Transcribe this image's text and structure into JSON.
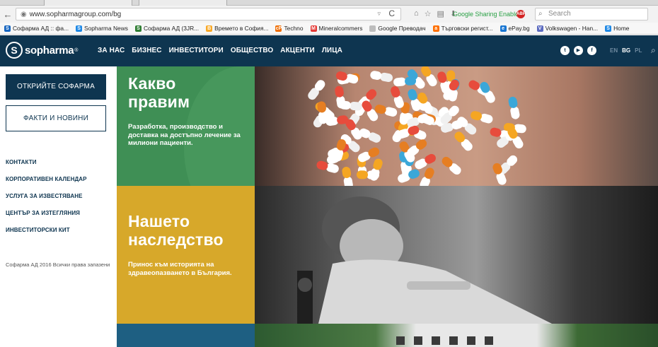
{
  "browser": {
    "url": "www.sopharmagroup.com/bg",
    "google_sharing": "Google Sharing Enabled",
    "search_placeholder": "Search",
    "bookmarks": [
      {
        "label": "Софарма АД :: фа...",
        "color": "#1565c0",
        "glyph": "S"
      },
      {
        "label": "Sopharma News",
        "color": "#1e88e5",
        "glyph": "S"
      },
      {
        "label": "Софарма АД (3JR...",
        "color": "#2e7d32",
        "glyph": "S"
      },
      {
        "label": "Времето в София...",
        "color": "#f9a825",
        "glyph": "B"
      },
      {
        "label": "Techno",
        "color": "#ef6c00",
        "glyph": "cP"
      },
      {
        "label": "Mineralcommers",
        "color": "#e53935",
        "glyph": "M"
      },
      {
        "label": "Google Преводач",
        "color": "#bdbdbd",
        "glyph": ""
      },
      {
        "label": "Търговски регист...",
        "color": "#ff6f00",
        "glyph": "a"
      },
      {
        "label": "ePay.bg",
        "color": "#1976d2",
        "glyph": "e"
      },
      {
        "label": "Volkswagen - Han...",
        "color": "#5c6bc0",
        "glyph": "V"
      },
      {
        "label": "Home",
        "color": "#1e88e5",
        "glyph": "S"
      }
    ]
  },
  "site": {
    "logo_text": "sopharma",
    "nav": [
      "ЗА НАС",
      "БИЗНЕС",
      "ИНВЕСТИТОРИ",
      "ОБЩЕСТВО",
      "АКЦЕНТИ",
      "ЛИЦА"
    ],
    "languages": {
      "en": "EN",
      "bg": "BG",
      "pl": "PL"
    }
  },
  "sidebar": {
    "primary_button": "ОТКРИЙТЕ СОФАРМА",
    "secondary_button": "ФАКТИ И НОВИНИ",
    "links": [
      "КОНТАКТИ",
      "КОРПОРАТИВЕН КАЛЕНДАР",
      "УСЛУГА ЗА ИЗВЕСТЯВАНЕ",
      "ЦЕНТЪР ЗА ИЗТЕГЛЯНИЯ",
      "ИНВЕСТИТОРСКИ КИТ"
    ],
    "copyright": "Софарма АД 2016 Всички права запазени"
  },
  "tiles": {
    "what_we_do": {
      "title_1": "Какво",
      "title_2": "правим",
      "subtitle": "Разработка, производство и доставка на достъпно лечение за милиони пациенти."
    },
    "heritage": {
      "title_1": "Нашето",
      "title_2": "наследство",
      "subtitle": "Принос към историята на здравеопазването в България."
    }
  },
  "colors": {
    "brand_navy": "#0e3550",
    "tile_green": "#3f8f55",
    "tile_yellow": "#d7a82a",
    "tile_teal": "#1e5f82"
  }
}
